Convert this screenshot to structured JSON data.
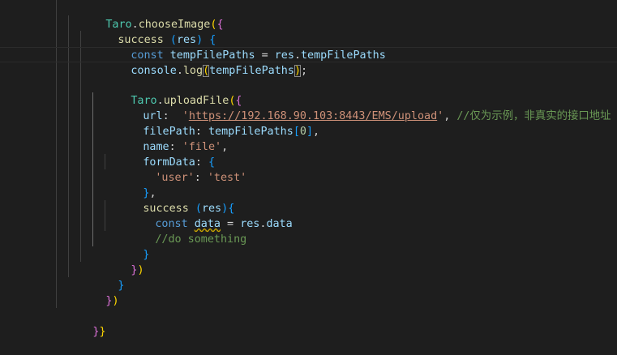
{
  "editor": {
    "lines": [
      {
        "id": "l1",
        "tokens": [
          "Taro",
          ".",
          "chooseImage",
          "(",
          "{"
        ]
      },
      {
        "id": "l2",
        "tokens": [
          "success",
          " (",
          "res",
          ") ",
          "{"
        ]
      },
      {
        "id": "l3",
        "tokens": [
          "const",
          " ",
          "tempFilePaths",
          " = ",
          "res",
          ".",
          "tempFilePaths"
        ]
      },
      {
        "id": "l4",
        "tokens": [
          "console",
          ".",
          "log",
          "(",
          "tempFilePaths",
          ")",
          ";"
        ]
      },
      {
        "id": "l5",
        "tokens": []
      },
      {
        "id": "l6",
        "tokens": [
          "Taro",
          ".",
          "uploadFile",
          "(",
          "{"
        ]
      },
      {
        "id": "l7",
        "tokens": [
          "url",
          ":  ",
          "'",
          "https://192.168.90.103:8443/EMS/upload",
          "'",
          ", ",
          "//仅为示例，非真实的接口地址"
        ]
      },
      {
        "id": "l8",
        "tokens": [
          "filePath",
          ": ",
          "tempFilePaths",
          "[",
          "0",
          "]",
          ","
        ]
      },
      {
        "id": "l9",
        "tokens": [
          "name",
          ": ",
          "'file'",
          ","
        ]
      },
      {
        "id": "l10",
        "tokens": [
          "formData",
          ": ",
          "{"
        ]
      },
      {
        "id": "l11",
        "tokens": [
          "'user'",
          ": ",
          "'test'"
        ]
      },
      {
        "id": "l12",
        "tokens": [
          "}",
          ","
        ]
      },
      {
        "id": "l13",
        "tokens": [
          "success",
          " (",
          "res",
          ")",
          "{"
        ]
      },
      {
        "id": "l14",
        "tokens": [
          "const",
          " ",
          "data",
          " = ",
          "res",
          ".",
          "data"
        ]
      },
      {
        "id": "l15",
        "tokens": [
          "//do something"
        ]
      },
      {
        "id": "l16",
        "tokens": [
          "}"
        ]
      },
      {
        "id": "l17",
        "tokens": [
          "}",
          ")"
        ]
      },
      {
        "id": "l18",
        "tokens": [
          "}"
        ]
      },
      {
        "id": "l19",
        "tokens": [
          "}",
          ")"
        ]
      },
      {
        "id": "l20",
        "tokens": []
      },
      {
        "id": "l21",
        "tokens": [
          "}",
          "}"
        ]
      }
    ]
  },
  "colors": {
    "background": "#1e1e1e",
    "keyword": "#569cd6",
    "variable": "#9cdcfe",
    "function": "#dcdcaa",
    "class": "#4ec9b0",
    "string": "#ce9178",
    "number": "#b5cea8",
    "comment": "#6a9955",
    "bracket_gold": "#ffd700",
    "bracket_orchid": "#da70d6",
    "bracket_blue": "#179fff"
  }
}
